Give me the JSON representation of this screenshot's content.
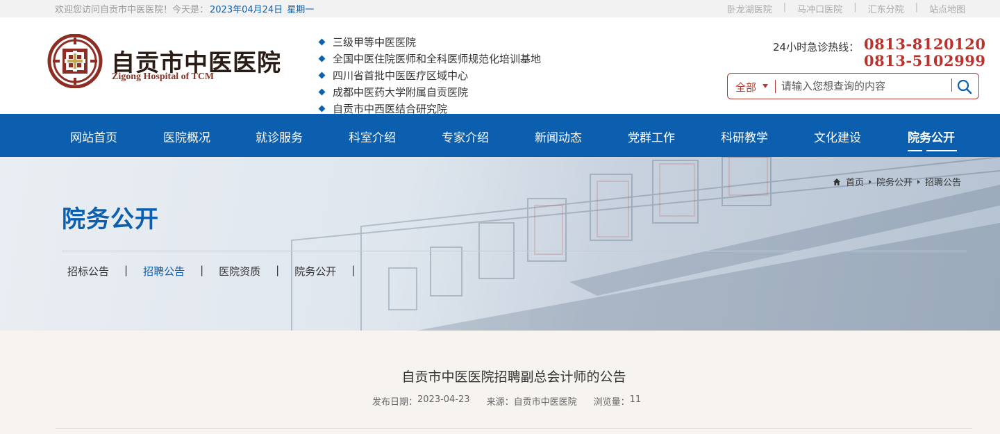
{
  "topbar": {
    "welcome": "欢迎您访问自贡市中医医院！今天是：",
    "date": "2023年04月24日",
    "weekday": "星期一",
    "links": [
      "卧龙湖医院",
      "马冲口医院",
      "汇东分院",
      "站点地图"
    ]
  },
  "header": {
    "logo_cn": "自贡市中医医院",
    "logo_en": "Zigong Hospital of TCM",
    "honors": [
      "三级甲等中医医院",
      "全国中医住院医师和全科医师规范化培训基地",
      "四川省首批中医医疗区域中心",
      "成都中医药大学附属自贡医院",
      "自贡市中西医结合研究院"
    ],
    "hotline_label": "24小时急诊热线：",
    "hotline_1": "0813-8120120",
    "hotline_2": "0813-5102999",
    "search_scope": "全部",
    "search_placeholder": "请输入您想查询的内容"
  },
  "nav": {
    "items": [
      "网站首页",
      "医院概况",
      "就诊服务",
      "科室介绍",
      "专家介绍",
      "新闻动态",
      "党群工作",
      "科研教学",
      "文化建设",
      "院务公开"
    ],
    "active_index": 9
  },
  "banner": {
    "breadcrumb": [
      "首页",
      "院务公开",
      "招聘公告"
    ],
    "title": "院务公开",
    "subnav": [
      "招标公告",
      "招聘公告",
      "医院资质",
      "院务公开"
    ],
    "subnav_active": 1
  },
  "article": {
    "title": "自贡市中医医院招聘副总会计师的公告",
    "date_label": "发布日期：",
    "date": "2023-04-23",
    "source_label": "来源：",
    "source": "自贡市中医医院",
    "views_label": "浏览量：",
    "views": "11"
  },
  "colors": {
    "primary_blue": "#0b5fae",
    "brand_red": "#b8332e",
    "background": "#f7f4ef"
  },
  "icons": [
    "emblem-icon",
    "diamond-bullet-icon",
    "caret-down-icon",
    "search-icon",
    "home-icon",
    "breadcrumb-arrow-icon"
  ]
}
